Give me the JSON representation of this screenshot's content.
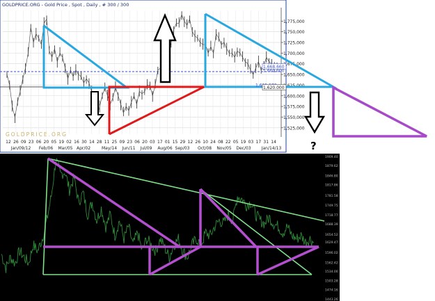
{
  "header": {
    "title": "GOLDPRICE.ORG - Gold Price , Spot , Daily , # 300 / 300",
    "watermark": "GOLDPRICE.ORG",
    "question_mark": "?"
  },
  "chart_data": [
    {
      "type": "line",
      "title": "GOLDPRICE.ORG - Gold Price , Spot , Daily , # 300 / 300",
      "xlabel": "",
      "ylabel": "",
      "ylim": [
        1510,
        1800
      ],
      "y_ticks": [
        "1,775,000",
        "1,750,000",
        "1,725,000",
        "1,700,000",
        "1,675,000",
        "1,650,000",
        "1,625,000",
        "1,600,000",
        "1,575,000",
        "1,550,000",
        "1,525,000"
      ],
      "x_tick_days": [
        "12",
        "26",
        "09",
        "23",
        "06",
        "20",
        "05",
        "19",
        "02",
        "16",
        "30",
        "14",
        "28",
        "11",
        "25",
        "09",
        "23",
        "06",
        "20",
        "03",
        "17",
        "01",
        "15",
        "29",
        "12",
        "26",
        "10",
        "24",
        "08",
        "22",
        "05",
        "19",
        "03",
        "17",
        "31",
        "14"
      ],
      "x_month_labels": [
        "Jan/09/12",
        "Feb/06",
        "Mar/05",
        "Apr/02",
        "May/14",
        "Jun/11",
        "Jul/09",
        "Aug/06",
        "Sep/03",
        "Oct/08",
        "Nov/05",
        "Dec/03",
        "Jan/14/13"
      ],
      "price_labels": [
        {
          "text": "1,668.660",
          "value": 1668.66
        },
        {
          "text": "1,660.000",
          "value": 1660.0
        },
        {
          "text": "1,625.570",
          "value": 1625.57
        },
        {
          "text": "1,620.000",
          "value": 1620.0
        }
      ],
      "series": [
        {
          "values": [
            1650,
            1625,
            1575,
            1550,
            1585,
            1610,
            1640,
            1665,
            1700,
            1760,
            1725,
            1745,
            1735,
            1720,
            1770,
            1780,
            1705,
            1690,
            1710,
            1680,
            1700,
            1690,
            1665,
            1640,
            1660,
            1645,
            1660,
            1650,
            1645,
            1630,
            1640,
            1630,
            1610,
            1580,
            1550,
            1575,
            1600,
            1620,
            1600,
            1580,
            1595,
            1620,
            1600,
            1580,
            1560,
            1575,
            1565,
            1585,
            1600,
            1580,
            1610,
            1605,
            1610,
            1625,
            1625,
            1600,
            1625,
            1660,
            1665,
            1680,
            1700,
            1700,
            1725,
            1755,
            1770,
            1770,
            1790,
            1775,
            1765,
            1780,
            1750,
            1740,
            1735,
            1725,
            1720,
            1720,
            1700,
            1715,
            1700,
            1745,
            1735,
            1720,
            1725,
            1710,
            1700,
            1700,
            1690,
            1705,
            1700,
            1690,
            1680,
            1675,
            1660,
            1650,
            1665,
            1680,
            1660,
            1670,
            1690,
            1680,
            1675,
            1665,
            1670
          ]
        }
      ],
      "annotations": {
        "cyan_triangles": 2,
        "red_triangle": 1,
        "black_arrows": [
          "down",
          "up",
          "down",
          "down"
        ],
        "projection_triangle_color": "#a64ac9"
      }
    },
    {
      "type": "line",
      "title": "",
      "y_ticks": [
        "1909.40",
        "1879.62",
        "1846.80",
        "1817.86",
        "1781.58",
        "1749.75",
        "1718.77",
        "1688.39",
        "1654.52",
        "1629.47",
        "1596.02",
        "1562.42",
        "1534.00",
        "1503.28",
        "1474.16",
        "1443.26"
      ],
      "series": [
        {
          "values": [
            1590,
            1545,
            1580,
            1560,
            1600,
            1580,
            1560,
            1620,
            1600,
            1640,
            1700,
            1780,
            1900,
            1850,
            1860,
            1800,
            1840,
            1760,
            1790,
            1720,
            1760,
            1700,
            1740,
            1680,
            1720,
            1650,
            1700,
            1640,
            1680,
            1620,
            1660,
            1600,
            1640,
            1620,
            1600,
            1640,
            1610,
            1580,
            1620,
            1640,
            1600,
            1580,
            1620,
            1640,
            1620,
            1660,
            1650,
            1680,
            1700,
            1690,
            1720,
            1700,
            1780,
            1770,
            1750,
            1760,
            1720,
            1700,
            1690,
            1710,
            1690,
            1680,
            1660,
            1680,
            1650,
            1640,
            1650,
            1630,
            1640,
            1625
          ]
        }
      ],
      "colors": {
        "price": "#2f8a3a",
        "trendlines": "#7fe08a",
        "pattern": "#b44fcf"
      }
    }
  ]
}
